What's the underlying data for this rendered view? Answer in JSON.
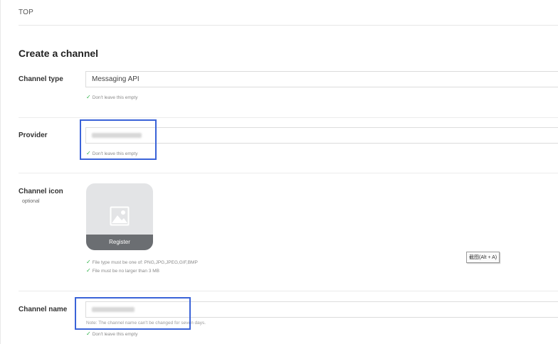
{
  "breadcrumb": "TOP",
  "page_title": "Create a channel",
  "channel_type": {
    "label": "Channel type",
    "value": "Messaging API",
    "hint": "Don't leave this empty"
  },
  "provider": {
    "label": "Provider",
    "hint": "Don't leave this empty"
  },
  "channel_icon": {
    "label": "Channel icon",
    "optional": "optional",
    "register_label": "Register",
    "hints": [
      "File type must be one of: PNG,JPG,JPEG,GIF,BMP",
      "File must be no larger than 3 MB"
    ]
  },
  "channel_name": {
    "label": "Channel name",
    "note": "Note: The channel name can't be changed for seven days.",
    "hint": "Don't leave this empty"
  },
  "tooltip": "截图(Alt + A)",
  "colors": {
    "highlight": "#3a63d8",
    "check": "#2fb34a",
    "register_bg": "#6b6e72"
  },
  "icons": [
    "check-icon",
    "image-placeholder-icon"
  ]
}
